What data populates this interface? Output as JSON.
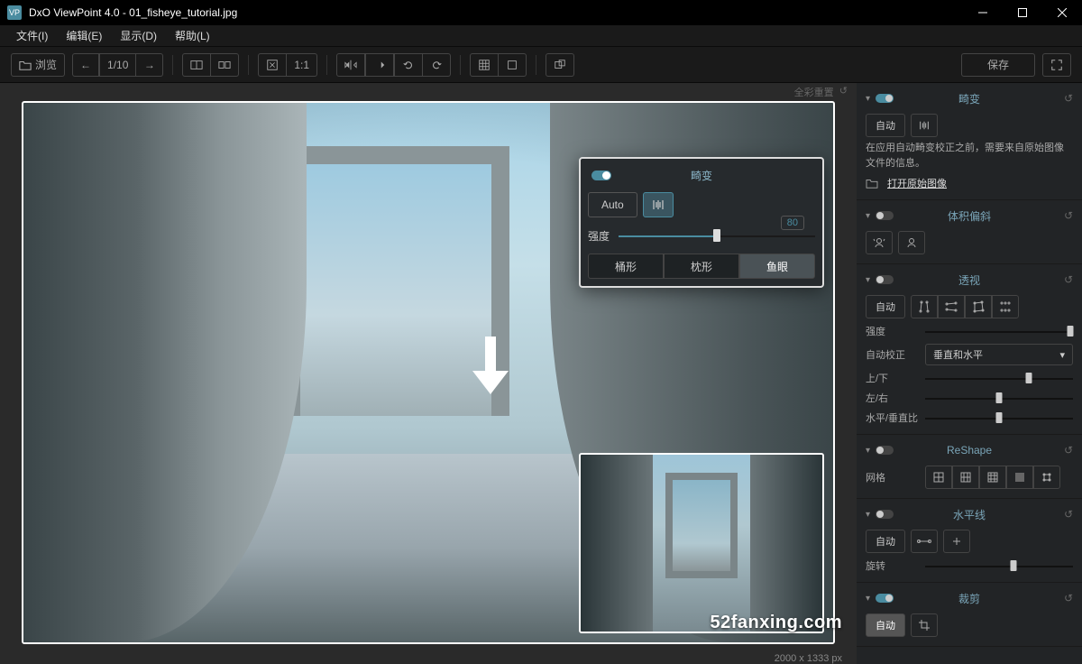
{
  "titlebar": {
    "app": "DxO ViewPoint 4.0",
    "file": "01_fisheye_tutorial.jpg"
  },
  "menu": {
    "file": "文件(I)",
    "edit": "编辑(E)",
    "view": "显示(D)",
    "help": "帮助(L)"
  },
  "toolbar": {
    "browse": "浏览",
    "page": "1/10",
    "fit": "1:1",
    "save": "保存"
  },
  "canvas": {
    "reset_label": "全彩重置",
    "dimensions": "2000 x 1333 px"
  },
  "popup": {
    "title": "畸变",
    "auto": "Auto",
    "intensity_label": "强度",
    "intensity_value": "80",
    "tabs": {
      "barrel": "桶形",
      "pincushion": "枕形",
      "fisheye": "鱼眼"
    }
  },
  "sidebar": {
    "distortion": {
      "title": "畸变",
      "auto": "自动",
      "info": "在应用自动畸变校正之前，需要来自原始图像文件的信息。",
      "link": "打开原始图像"
    },
    "volume": {
      "title": "体积偏斜"
    },
    "perspective": {
      "title": "透视",
      "auto": "自动",
      "intensity": "强度",
      "auto_correct": "自动校正",
      "auto_correct_value": "垂直和水平",
      "up_down": "上/下",
      "left_right": "左/右",
      "ratio": "水平/垂直比"
    },
    "reshape": {
      "title": "ReShape",
      "grid": "网格"
    },
    "horizon": {
      "title": "水平线",
      "auto": "自动",
      "rotate": "旋转"
    },
    "crop": {
      "title": "裁剪",
      "auto": "自动"
    }
  },
  "watermark": "52fanxing.com"
}
